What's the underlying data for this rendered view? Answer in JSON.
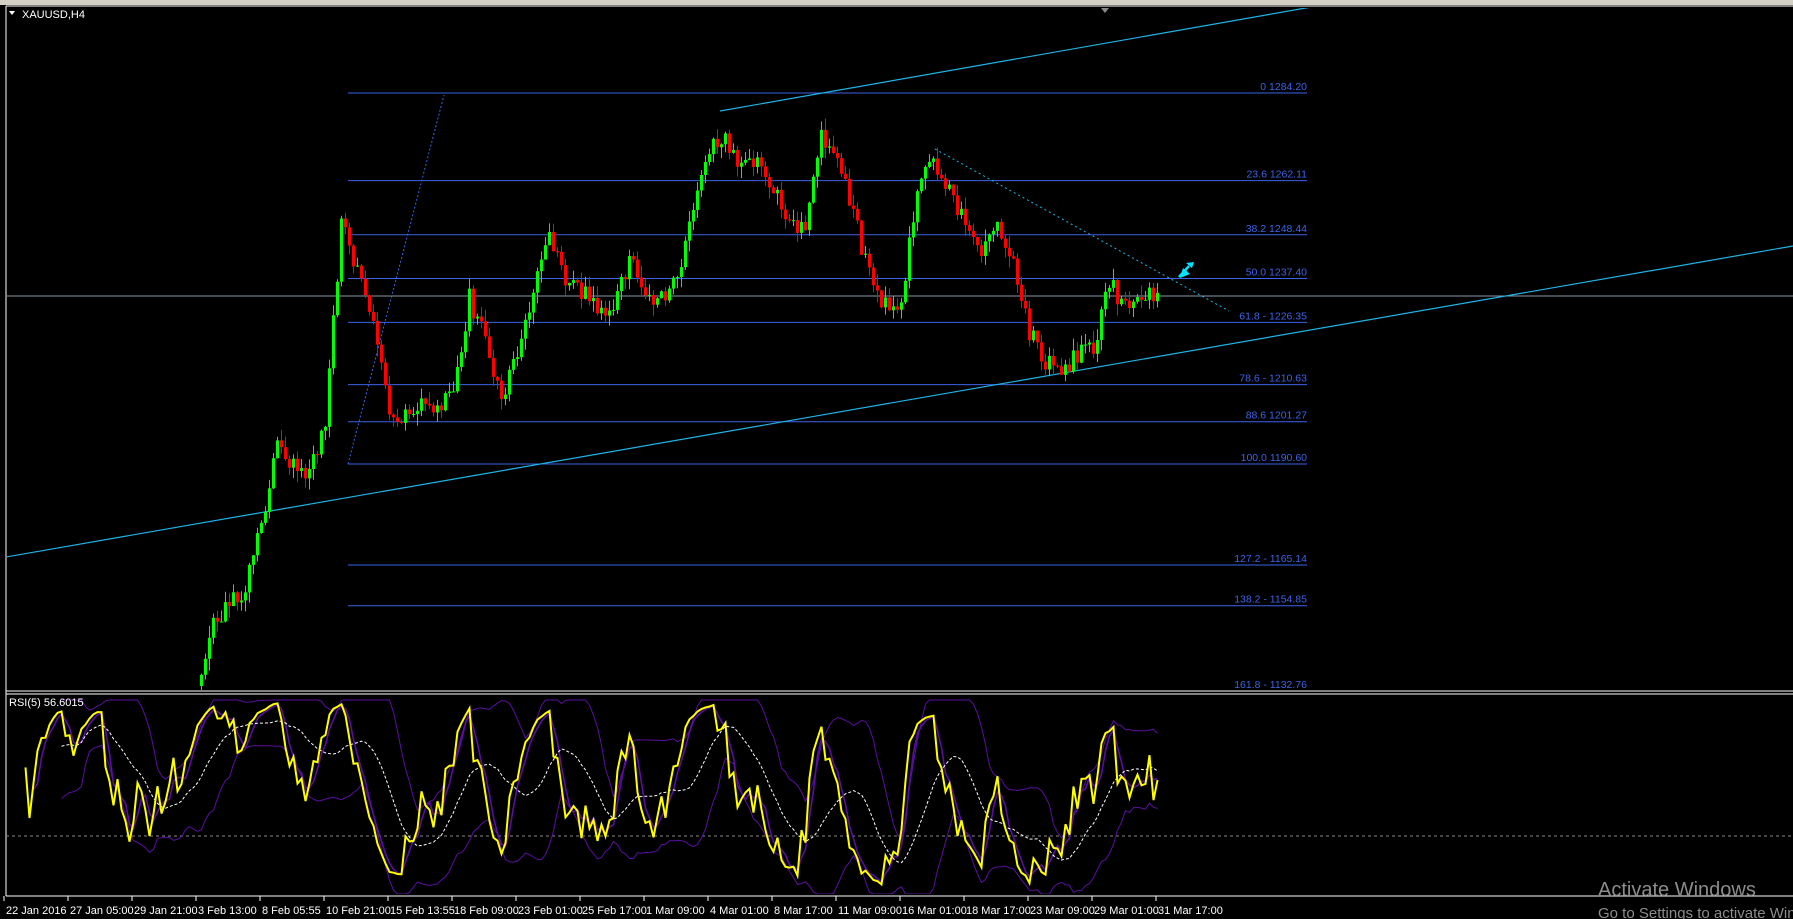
{
  "window": {
    "title": "XAUUSD,H4"
  },
  "rsi_panel": {
    "label": "RSI(5) 56.6015"
  },
  "watermark": {
    "line1": "Activate Windows",
    "line2": "Go to Settings to activate Windows."
  },
  "colors": {
    "background": "#000000",
    "bull": "#00ff00",
    "bear": "#ff0000",
    "fib": "#3d63e6",
    "trendline": "#1eb4e6",
    "rsi": "#ffff00",
    "rsi_bands": "#5a0fa0",
    "rsi_ma": "#ffffff",
    "price_line": "#8a9aa8"
  },
  "chart_data": {
    "type": "candlestick",
    "symbol": "XAUUSD",
    "timeframe": "H4",
    "x_tick_labels": [
      "22 Jan 2016",
      "27 Jan 05:00",
      "29 Jan 21:00",
      "3 Feb 13:00",
      "8 Feb 05:55",
      "10 Feb 21:00",
      "15 Feb 13:55",
      "18 Feb 09:00",
      "23 Feb 01:00",
      "25 Feb 17:00",
      "1 Mar 09:00",
      "4 Mar 01:00",
      "8 Mar 17:00",
      "11 Mar 09:00",
      "16 Mar 01:00",
      "18 Mar 17:00",
      "23 Mar 09:00",
      "29 Mar 01:00",
      "31 Mar 17:00"
    ],
    "approx_close_every_4_bars_from_3_Feb": [
      1134.6,
      1150.7,
      1155.1,
      1159.8,
      1176.1,
      1194.2,
      1191.5,
      1187.7,
      1201,
      1250.7,
      1240.3,
      1224.5,
      1203.2,
      1201.9,
      1207.9,
      1203.8,
      1208.5,
      1232.4,
      1221.6,
      1207.6,
      1219.7,
      1233.3,
      1247.8,
      1236,
      1234.2,
      1229.8,
      1231.3,
      1242.5,
      1232.6,
      1231.8,
      1238.4,
      1253.4,
      1270.6,
      1273.7,
      1264.4,
      1266.5,
      1260.7,
      1252.4,
      1250.3,
      1273.7,
      1270,
      1253.9,
      1237.8,
      1230.4,
      1231.7,
      1261.4,
      1266.8,
      1259.7,
      1251.1,
      1243.2,
      1250.3,
      1242.4,
      1224,
      1216.5,
      1213.2,
      1218.2,
      1219.4,
      1236.7,
      1229.8,
      1233.2,
      1232.7
    ],
    "current_price": 1233.0,
    "fibonacci": [
      {
        "level": "0",
        "price": 1284.2,
        "label": "0 1284.20"
      },
      {
        "level": "23.6",
        "price": 1262.11,
        "label": "23.6 1262.11"
      },
      {
        "level": "38.2",
        "price": 1248.44,
        "label": "38.2 1248.44"
      },
      {
        "level": "50.0",
        "price": 1237.4,
        "label": "50.0 1237.40"
      },
      {
        "level": "61.8",
        "price": 1226.35,
        "label": "61.8 - 1226.35"
      },
      {
        "level": "78.6",
        "price": 1210.63,
        "label": "78.6 - 1210.63"
      },
      {
        "level": "88.6",
        "price": 1201.27,
        "label": "88.6 1201.27"
      },
      {
        "level": "100.0",
        "price": 1190.6,
        "label": "100.0 1190.60"
      },
      {
        "level": "127.2",
        "price": 1165.14,
        "label": "127.2 - 1165.14"
      },
      {
        "level": "138.2",
        "price": 1154.85,
        "label": "138.2 - 1154.85"
      },
      {
        "level": "161.8",
        "price": 1132.76,
        "label": "161.8 -  1132.76"
      }
    ],
    "indicator": {
      "name": "RSI",
      "period": 5,
      "value": 56.6015,
      "level": 30,
      "ylim": [
        0,
        100
      ]
    }
  }
}
